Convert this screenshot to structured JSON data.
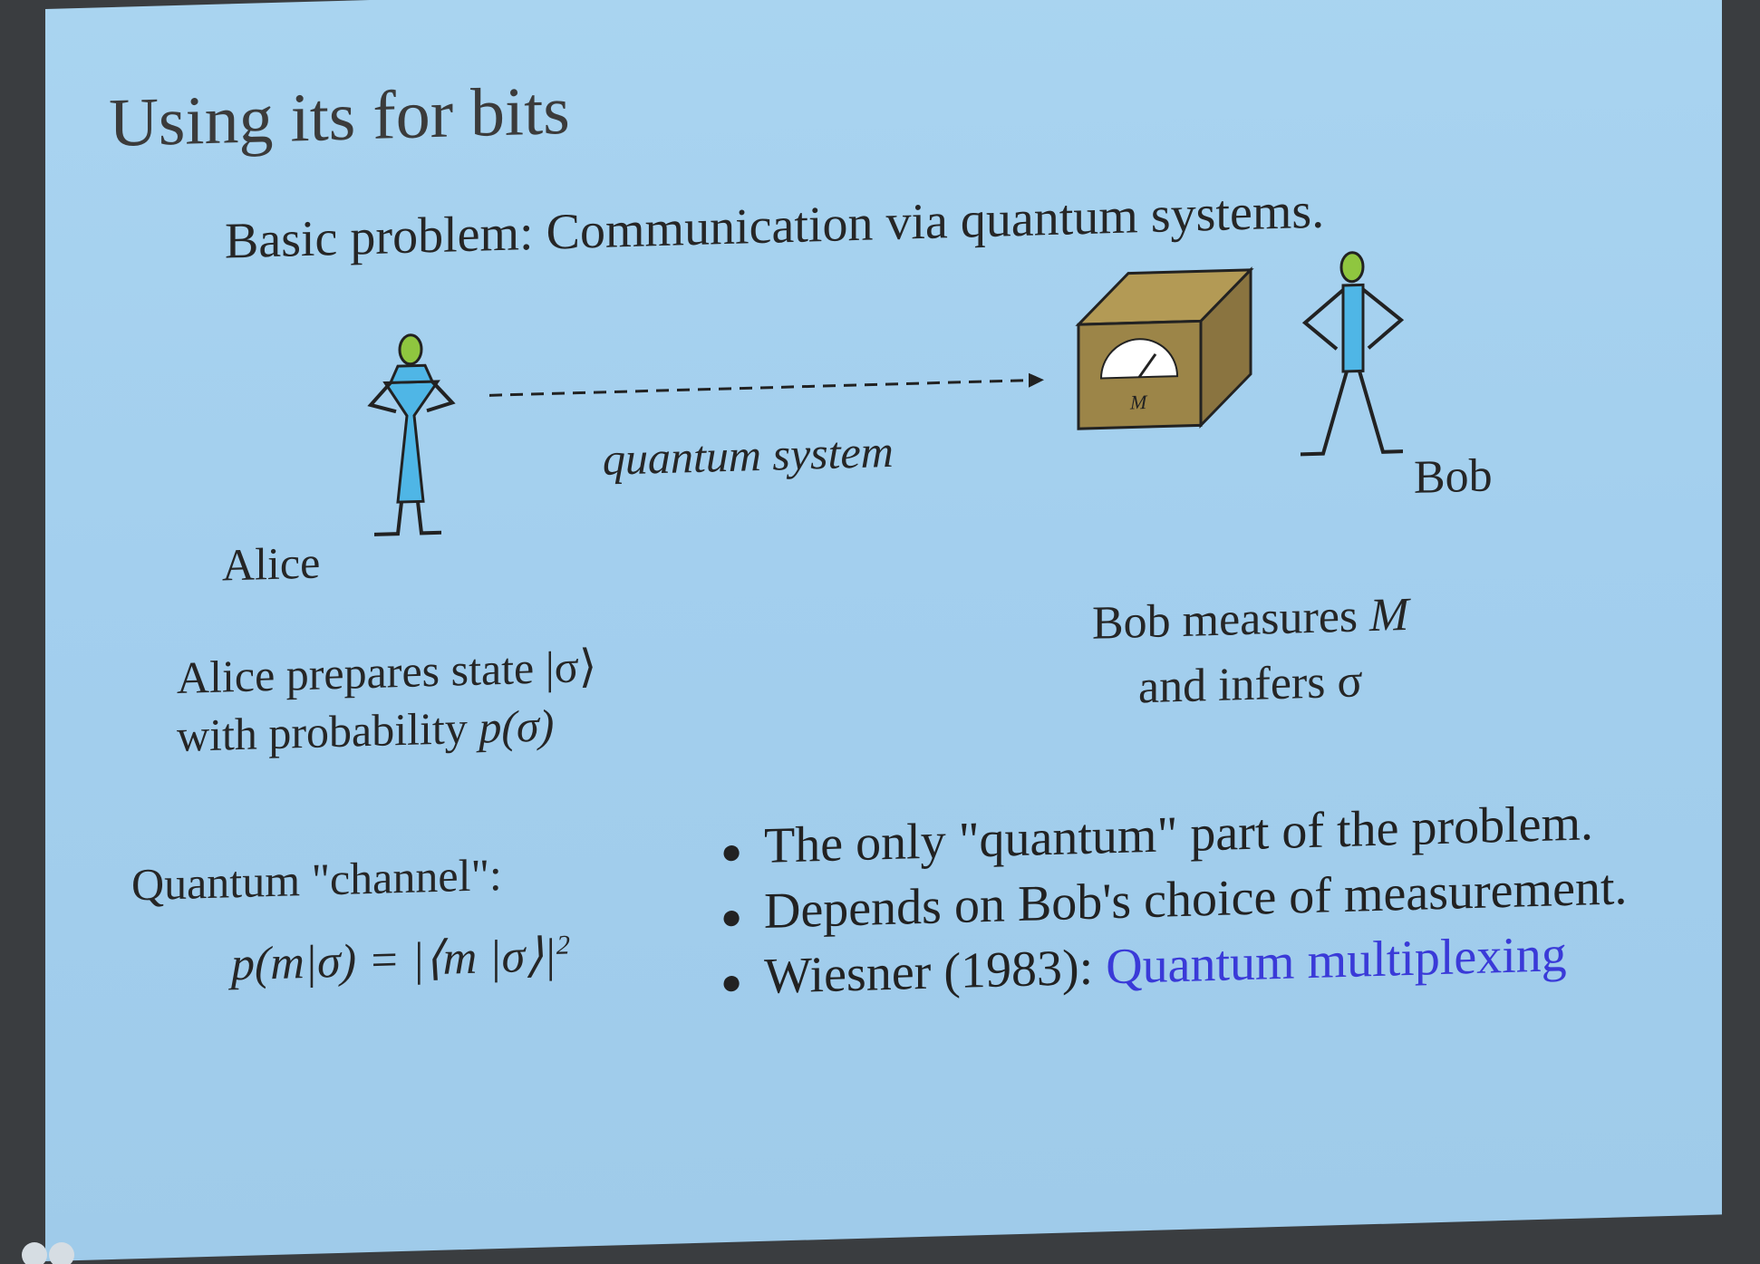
{
  "slide": {
    "title": "Using its for bits",
    "subtitle": "Basic problem:  Communication via quantum systems.",
    "diagram": {
      "channel_label": "quantum system",
      "alice_label": "Alice",
      "bob_label": "Bob",
      "device_label": "M"
    },
    "alice_description": {
      "line1": "Alice prepares state |σ⟩",
      "line2_prefix": "with probability ",
      "line2_formula": "p(σ)"
    },
    "bob_description": {
      "line1_prefix": "Bob measures ",
      "line1_var": "M",
      "line2": "and infers  σ"
    },
    "channel": {
      "label": "Quantum \"channel\":",
      "formula": "p(m|σ) = |⟨m |σ⟩|",
      "formula_exponent": "2"
    },
    "bullets": [
      {
        "text": "The only \"quantum\" part of the problem."
      },
      {
        "text": "Depends on Bob's choice of measurement."
      },
      {
        "text": "Wiesner (1983):  ",
        "link": "Quantum multiplexing"
      }
    ],
    "colors": {
      "background": "#a6d2ef",
      "link": "#3a3ad8",
      "box": "#9c8548",
      "figure_dress": "#4fb6e6",
      "figure_head": "#8fc63f"
    }
  }
}
